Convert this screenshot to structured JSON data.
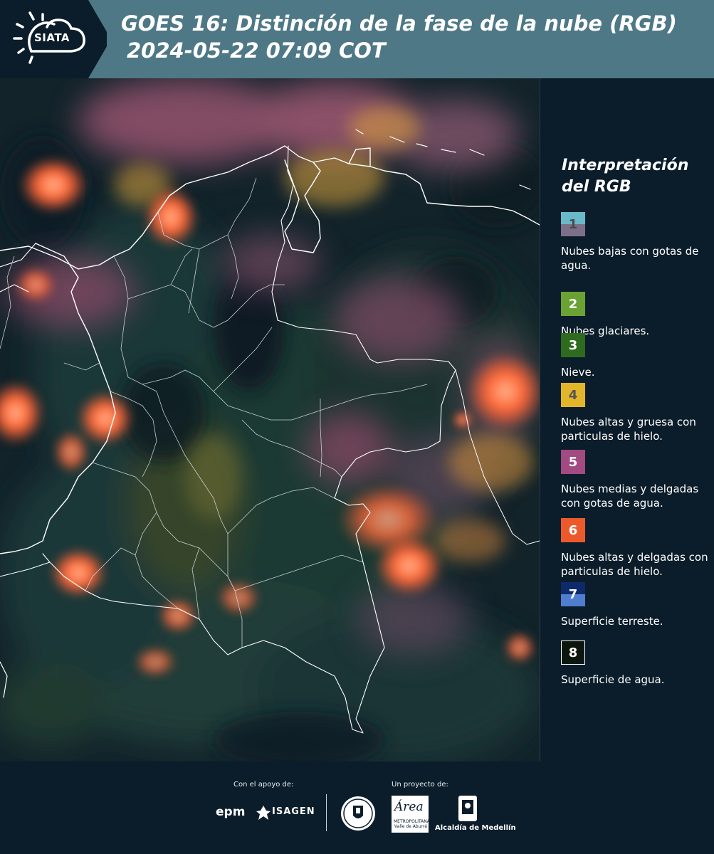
{
  "header": {
    "logo_text": "SIATA",
    "title_line1": "GOES 16: Distinción de la fase de la nube (RGB)",
    "title_line2": "2024-05-22 07:09 COT"
  },
  "colors": {
    "header_bg": "#4e7886",
    "page_bg": "#0b1d2a",
    "cloud_orange": "#ff6a3a",
    "cloud_pink": "#b4607e"
  },
  "legend": {
    "title": "Interpretación del RGB",
    "items": [
      {
        "number": "1",
        "label": "Nubes bajas con gotas de agua.",
        "color_top": "#6ab9c9",
        "color_bottom": "#7c6f8a",
        "number_color": "#4a4a4a"
      },
      {
        "number": "2",
        "label": "Nubes glaciares.",
        "color_top": "#6aa333",
        "color_bottom": "#6aa333",
        "number_color": "#ffffff"
      },
      {
        "number": "3",
        "label": "Nieve.",
        "color_top": "#2e6b1f",
        "color_bottom": "#2e6b1f",
        "number_color": "#ffffff"
      },
      {
        "number": "4",
        "label": "Nubes altas y gruesa con particulas de hielo.",
        "color_top": "#e2b52b",
        "color_bottom": "#e2b52b",
        "number_color": "#555555"
      },
      {
        "number": "5",
        "label": "Nubes medias y delgadas con gotas de agua.",
        "color_top": "#a24a82",
        "color_bottom": "#a24a82",
        "number_color": "#ffffff"
      },
      {
        "number": "6",
        "label": "Nubes altas y delgadas con particulas de hielo.",
        "color_top": "#ec5a2c",
        "color_bottom": "#ec5a2c",
        "number_color": "#ffffff"
      },
      {
        "number": "7",
        "label": "Superficie terreste.",
        "color_top": "#0f2a6b",
        "color_bottom": "#4f7ed0",
        "number_color": "#ffffff"
      },
      {
        "number": "8",
        "label": "Superficie de agua.",
        "color_top": "#0d160d",
        "color_bottom": "#0d160d",
        "number_color": "#ffffff"
      }
    ]
  },
  "footer": {
    "support_caption": "Con el apoyo de:",
    "project_caption": "Un proyecto de:",
    "sponsor1": "epm",
    "sponsor2": "ISAGEN",
    "area_logo_text": "Área",
    "area_logo_sub": "METROPOLITANA Valle de Aburrá",
    "alcaldia": "Alcaldía de Medellín"
  },
  "map": {
    "icons": [
      "sun-cloud-logo-icon",
      "isagen-icon",
      "seal-icon",
      "alcaldia-emblem-icon"
    ]
  }
}
